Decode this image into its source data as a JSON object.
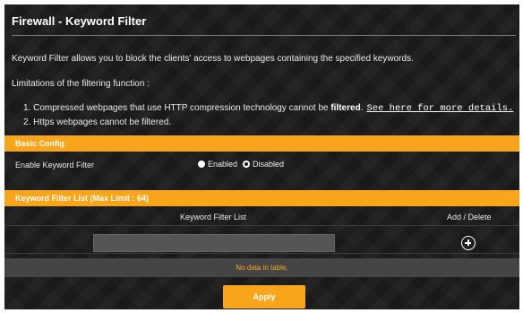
{
  "page": {
    "title": "Firewall - Keyword Filter",
    "intro": "Keyword Filter allows you to block the clients' access to webpages containing the specified keywords.",
    "limitations_heading": "Limitations of the filtering function :",
    "limitation_1_prefix": "1. Compressed webpages that use HTTP compression technology cannot be ",
    "limitation_1_bold": "filtered",
    "limitation_1_suffix": ".",
    "limitation_1_link": "See here for more details.",
    "limitation_2": "2. Https webpages cannot be filtered."
  },
  "basic_config": {
    "header": "Basic Config",
    "enable_label": "Enable Keyword Filter",
    "options": [
      {
        "label": "Enabled",
        "selected": true
      },
      {
        "label": "Disabled",
        "selected": false
      }
    ]
  },
  "keyword_list": {
    "header": "Keyword Filter List (Max Limit : 64)",
    "columns": [
      "Keyword Filter List",
      "Add / Delete"
    ],
    "input_value": "",
    "empty_message": "No data in table."
  },
  "actions": {
    "apply_label": "Apply"
  },
  "colors": {
    "accent": "#f8a51b",
    "background": "#1b1b1b",
    "input": "#555555"
  }
}
